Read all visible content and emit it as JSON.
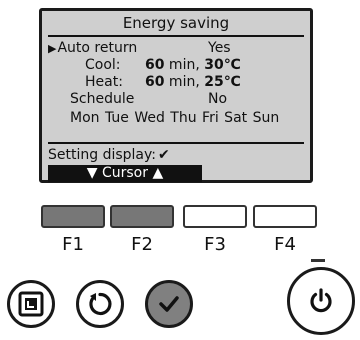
{
  "screen": {
    "title": "Energy saving",
    "auto_return": {
      "label": "Auto return",
      "value": "Yes"
    },
    "cool": {
      "label": "Cool:",
      "minutes": "60",
      "min_unit": " min, ",
      "temp": "30℃"
    },
    "heat": {
      "label": "Heat:",
      "minutes": "60",
      "min_unit": " min, ",
      "temp": "25℃"
    },
    "schedule": {
      "label": "Schedule",
      "value": "No"
    },
    "days": "Mon Tue Wed Thu Fri Sat Sun",
    "setting_display": "Setting display:",
    "setting_check": "✔",
    "cursor_bar": "▼ Cursor ▲"
  },
  "function_keys": [
    {
      "label": "F1"
    },
    {
      "label": "F2"
    },
    {
      "label": "F3"
    },
    {
      "label": "F4"
    }
  ]
}
